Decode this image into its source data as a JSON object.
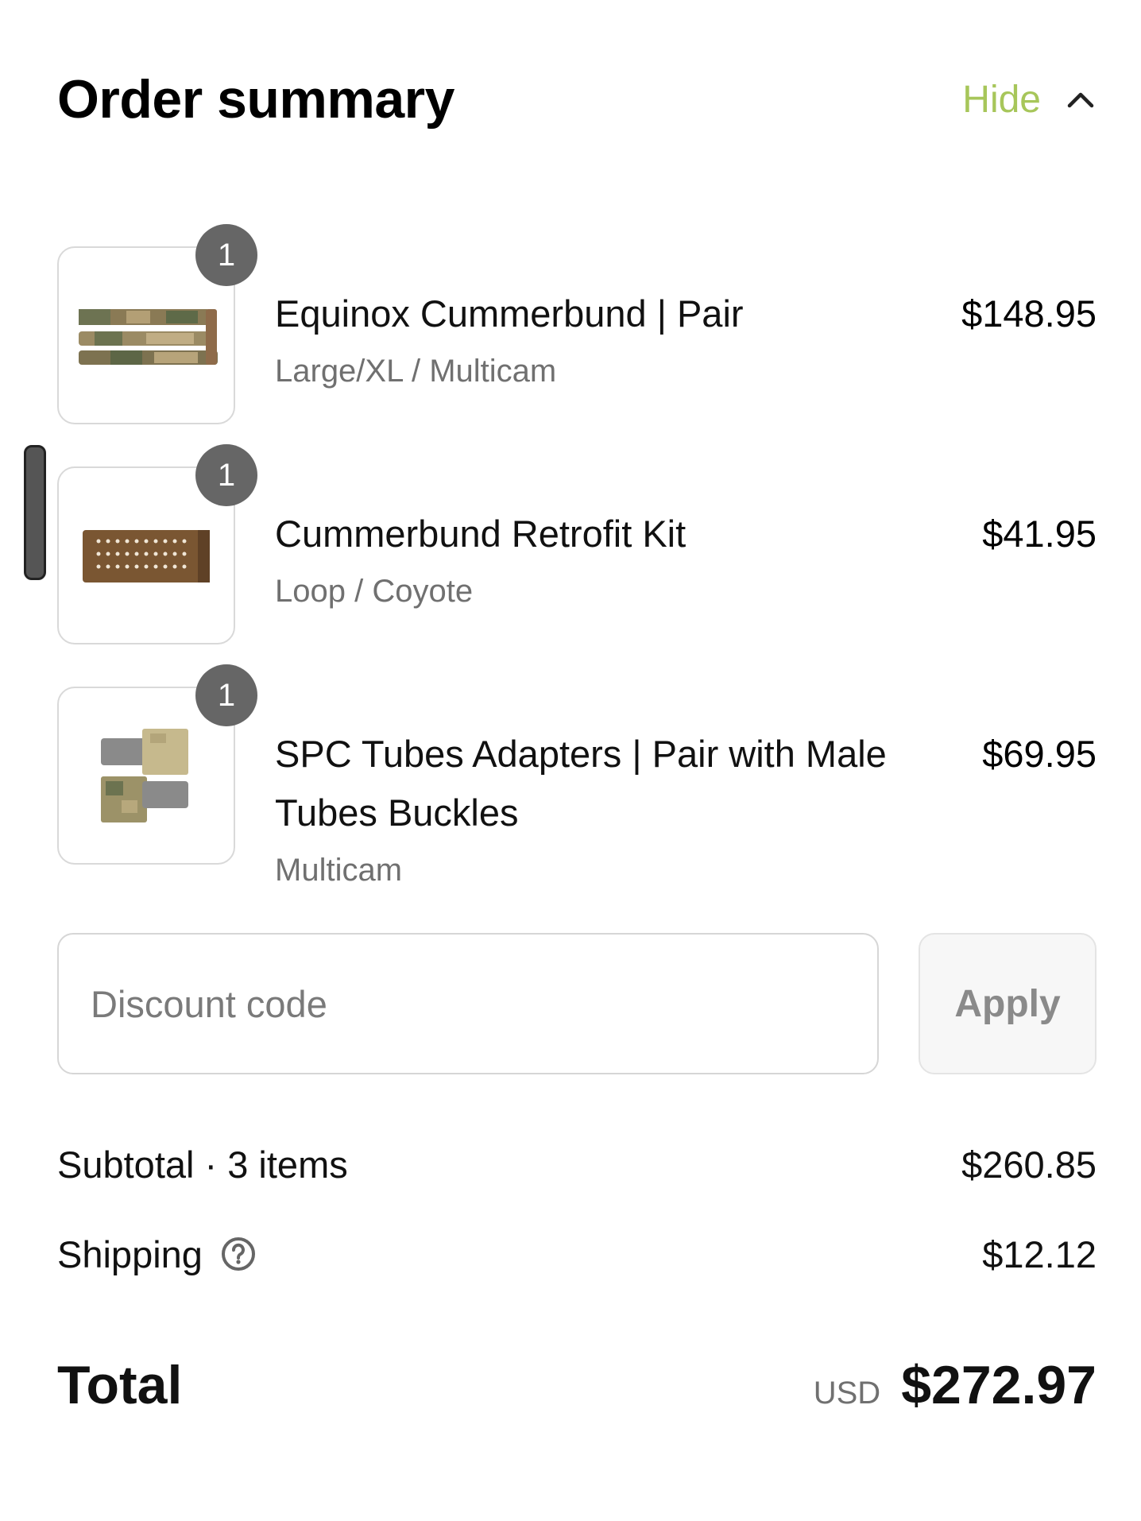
{
  "header": {
    "title": "Order summary",
    "toggle_label": "Hide"
  },
  "items": [
    {
      "quantity": "1",
      "title": "Equinox Cummerbund | Pair",
      "variant": "Large/XL / Multicam",
      "price": "$148.95"
    },
    {
      "quantity": "1",
      "title": "Cummerbund Retrofit Kit",
      "variant": "Loop / Coyote",
      "price": "$41.95"
    },
    {
      "quantity": "1",
      "title": "SPC Tubes Adapters | Pair with Male Tubes Buckles",
      "variant": "Multicam",
      "price": "$69.95"
    }
  ],
  "discount": {
    "placeholder": "Discount code",
    "value": "",
    "apply_label": "Apply"
  },
  "summary": {
    "subtotal_label": "Subtotal · 3 items",
    "subtotal_value": "$260.85",
    "shipping_label": "Shipping",
    "shipping_value": "$12.12",
    "total_label": "Total",
    "currency": "USD",
    "total_value": "$272.97"
  },
  "colors": {
    "accent": "#a7c65a",
    "badge": "#666666"
  }
}
